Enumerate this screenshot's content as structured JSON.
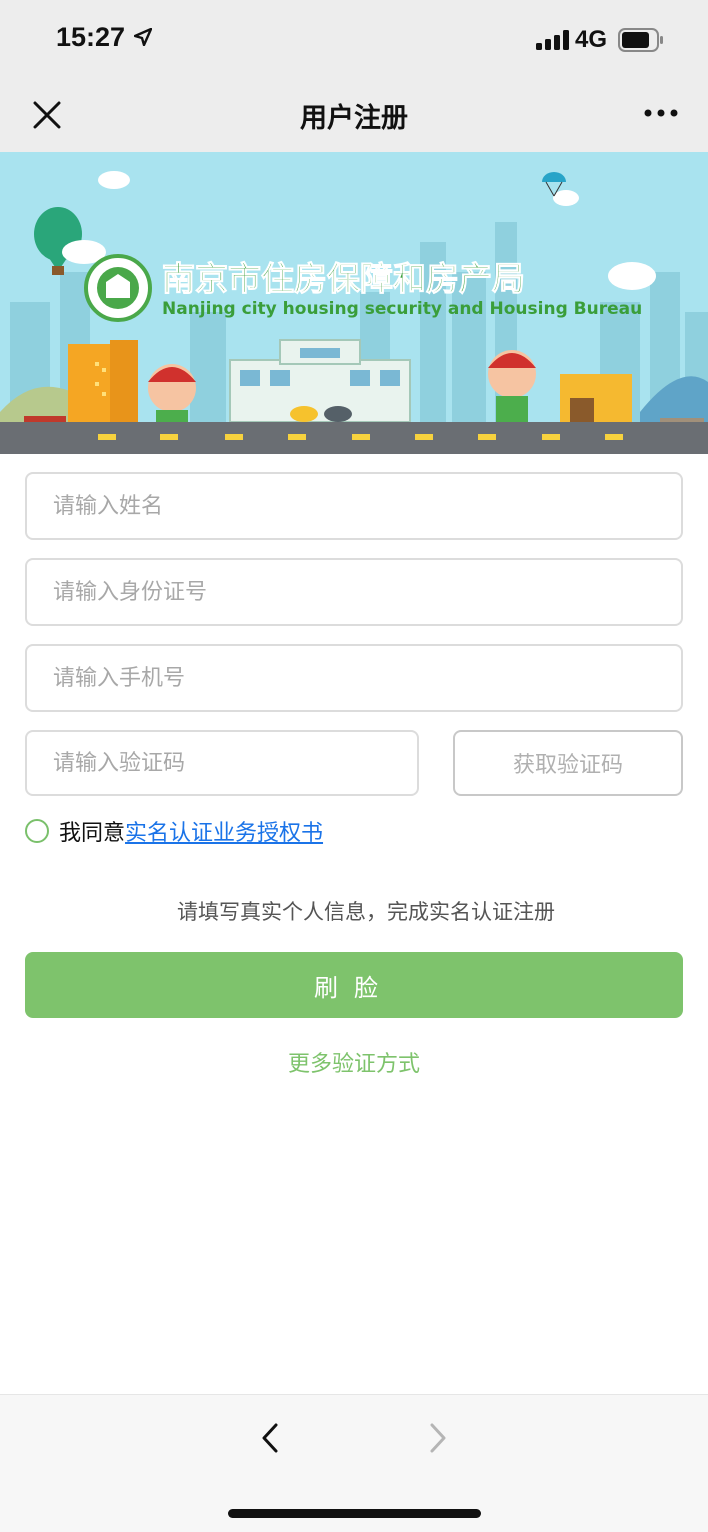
{
  "status_bar": {
    "time": "15:27",
    "network": "4G",
    "icons": [
      "location-arrow-icon",
      "signal-bars-icon",
      "battery-icon"
    ]
  },
  "nav": {
    "title": "用户注册",
    "close_icon": "close-icon",
    "more_icon": "more-dots-icon"
  },
  "banner": {
    "title_cn": "南京市住房保障和房产局",
    "title_en": "Nanjing city housing security and Housing Bureau"
  },
  "form": {
    "name_placeholder": "请输入姓名",
    "id_placeholder": "请输入身份证号",
    "phone_placeholder": "请输入手机号",
    "code_placeholder": "请输入验证码",
    "get_code_label": "获取验证码",
    "agree_prefix": "我同意",
    "agree_link": "实名认证业务授权书",
    "hint": "请填写真实个人信息，完成实名认证注册",
    "face_button": "刷脸",
    "more_methods": "更多验证方式"
  },
  "toolbar": {
    "back_icon": "chevron-left-icon",
    "forward_icon": "chevron-right-icon"
  },
  "colors": {
    "accent_green": "#7ec36c",
    "link_blue": "#1a73e8",
    "bar_gray": "#ededed",
    "sky": "#a9e3ef"
  }
}
